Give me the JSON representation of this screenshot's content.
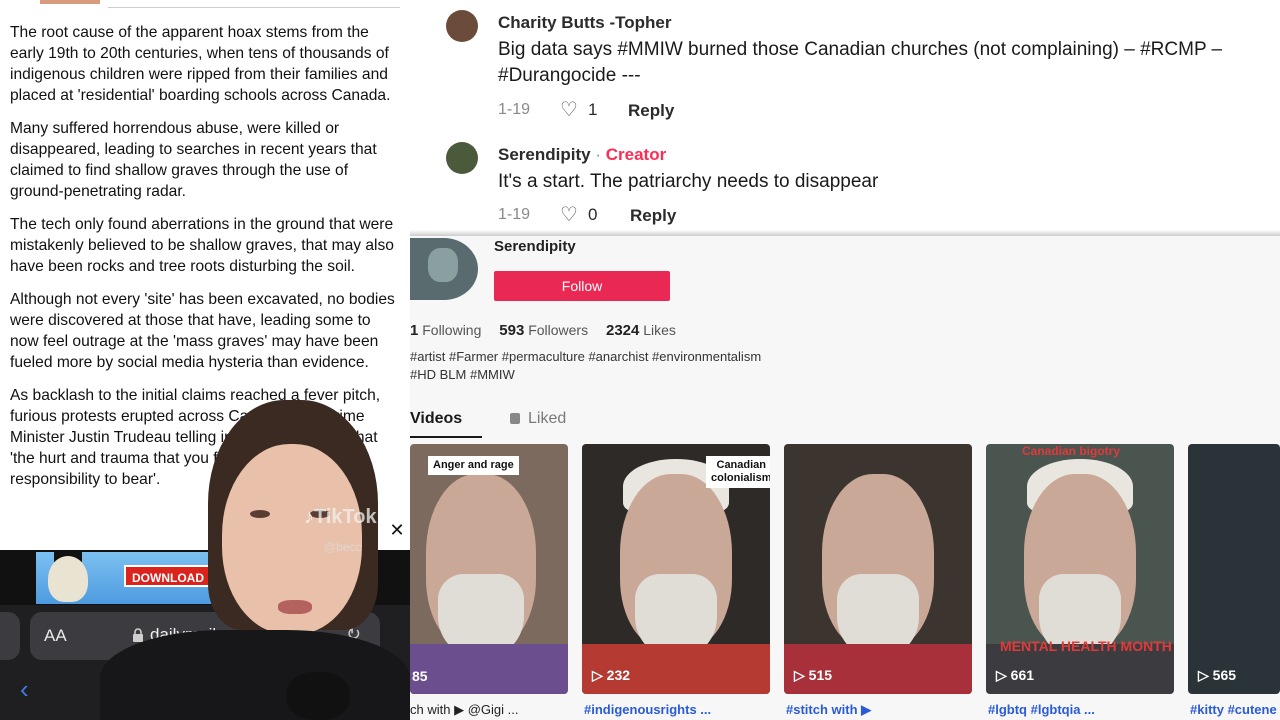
{
  "article": {
    "paragraphs": [
      "The root cause of the apparent hoax stems from the early 19th to 20th centuries, when tens of thousands of indigenous children were ripped from their families and placed at 'residential' boarding schools across Canada.",
      "Many suffered horrendous abuse, were killed or disappeared, leading to searches in recent years that claimed to find shallow graves through the use of ground-penetrating radar.",
      "The tech only found aberrations in the ground that were mistakenly believed to be shallow graves, that may also have been rocks and tree roots disturbing the soil.",
      "Although not every 'site' has been excavated,  no bodies were discovered at those that have, leading some to now feel outrage at the 'mass graves' may have been fueled more by social media hysteria than evidence.",
      "As backlash to the initial claims reached a fever pitch, furious protests erupted across Canada, with Prime Minister Justin Trudeau telling indigenous people that 'the hurt and trauma that you feel is Canada's responsibility to bear'."
    ]
  },
  "browser": {
    "ad_button": "DOWNLOAD NOW",
    "ad_close": "✕",
    "aa_label": "AA",
    "url": "dailymail.co.uk",
    "reload_icon": "reload-icon",
    "back": "‹"
  },
  "overlay": {
    "logo": "TikTok",
    "handle": "@becc"
  },
  "comments": [
    {
      "author": "Charity Butts -Topher",
      "creator_label": "",
      "text": "Big data says #MMIW burned those Canadian churches (not complaining) – #RCMP – #Durangocide ---",
      "date": "1-19",
      "likes": "1",
      "reply": "Reply"
    },
    {
      "author": "Serendipity",
      "creator_label": "Creator",
      "text": "It's a start. The patriarchy needs to disappear",
      "date": "1-19",
      "likes": "0",
      "reply": "Reply"
    }
  ],
  "profile": {
    "name": "Serendipity",
    "follow": "Follow",
    "following_count": "1",
    "following_label": "Following",
    "followers_count": "593",
    "followers_label": "Followers",
    "likes_count": "2324",
    "likes_label": "Likes",
    "bio_line1": "#artist #Farmer #permaculture #anarchist #environmentalism",
    "bio_line2": "#HD BLM #MMIW",
    "tab_videos": "Videos",
    "tab_liked": "Liked"
  },
  "videos": [
    {
      "tag": "Anger and rage",
      "views": "85",
      "caption_prefix": "ch with",
      "caption_tag": "▶ @Gigi ..."
    },
    {
      "tag": "Canadian colonialism",
      "views": "232",
      "caption_prefix": "",
      "caption_tag": "#indigenousrights ..."
    },
    {
      "tag": "",
      "views": "515",
      "caption_prefix": "",
      "caption_tag": "#stitch with ▶"
    },
    {
      "tag": "Canadian bigotry",
      "views": "661",
      "caption_prefix": "",
      "caption_tag": "#lgbtq #lgbtqia ...",
      "overlay": "MENTAL HEALTH MONTH"
    },
    {
      "tag": "",
      "views": "565",
      "caption_prefix": "",
      "caption_tag": "#kitty #cutene"
    }
  ],
  "colors": {
    "tiktok_red": "#fe2c55",
    "follow_bg": "#ea2854",
    "hashtag_blue": "#2a5bd7"
  }
}
